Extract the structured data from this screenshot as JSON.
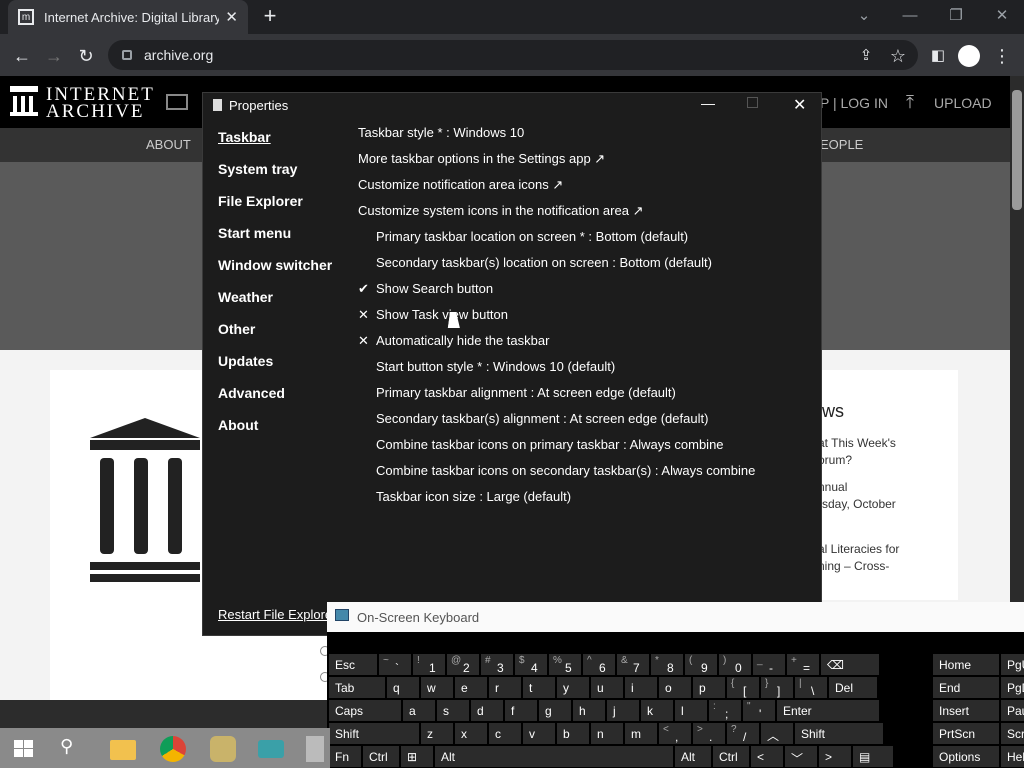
{
  "browser": {
    "tab_title": "Internet Archive: Digital Library o",
    "url": "archive.org"
  },
  "archive": {
    "logo_line1": "INTERNET",
    "logo_line2": "ARCHIVE",
    "header_right": "P | LOG IN",
    "upload": "UPLOAD",
    "nav_about": "ABOUT",
    "nav_people": "EOPLE",
    "news_title": "ws",
    "news_1": "at This Week's",
    "news_2": "orum?",
    "news_3": "nnual",
    "news_4": "rsday, October",
    "news_5": "al Literacies for",
    "news_6": "ning – Cross-",
    "news_7": ")"
  },
  "properties": {
    "title": "Properties",
    "sidebar": [
      "Taskbar",
      "System tray",
      "File Explorer",
      "Start menu",
      "Window switcher",
      "Weather",
      "Other",
      "Updates",
      "Advanced",
      "About"
    ],
    "options": [
      {
        "text": "Taskbar style * : Windows 10",
        "mark": "",
        "indent": false
      },
      {
        "text": "More taskbar options in the Settings app ↗",
        "mark": "",
        "indent": false
      },
      {
        "text": "Customize notification area icons ↗",
        "mark": "",
        "indent": false
      },
      {
        "text": "Customize system icons in the notification area ↗",
        "mark": "",
        "indent": false
      },
      {
        "text": "Primary taskbar location on screen * : Bottom (default)",
        "mark": "",
        "indent": true
      },
      {
        "text": "Secondary taskbar(s) location on screen : Bottom (default)",
        "mark": "",
        "indent": true
      },
      {
        "text": "Show Search button",
        "mark": "✔",
        "indent": true
      },
      {
        "text": "Show Task view button",
        "mark": "✕",
        "indent": true
      },
      {
        "text": "Automatically hide the taskbar",
        "mark": "✕",
        "indent": true
      },
      {
        "text": "Start button style * : Windows 10 (default)",
        "mark": "",
        "indent": true
      },
      {
        "text": "Primary taskbar alignment : At screen edge (default)",
        "mark": "",
        "indent": true
      },
      {
        "text": "Secondary taskbar(s) alignment : At screen edge (default)",
        "mark": "",
        "indent": true
      },
      {
        "text": "Combine taskbar icons on primary taskbar : Always combine",
        "mark": "",
        "indent": true
      },
      {
        "text": "Combine taskbar icons on secondary taskbar(s) : Always combine",
        "mark": "",
        "indent": true
      },
      {
        "text": "Taskbar icon size : Large (default)",
        "mark": "",
        "indent": true
      }
    ],
    "restart": "Restart File Explorer (",
    "colors": {
      "background": "#1c1c1c",
      "text": "#ffffff"
    }
  },
  "osk": {
    "title": "On-Screen Keyboard",
    "rows": [
      [
        {
          "m": "Esc",
          "w": 50
        },
        {
          "s": "~",
          "l": "`",
          "w": 34
        },
        {
          "s": "!",
          "l": "1",
          "w": 34
        },
        {
          "s": "@",
          "l": "2",
          "w": 34
        },
        {
          "s": "#",
          "l": "3",
          "w": 34
        },
        {
          "s": "$",
          "l": "4",
          "w": 34
        },
        {
          "s": "%",
          "l": "5",
          "w": 34
        },
        {
          "s": "^",
          "l": "6",
          "w": 34
        },
        {
          "s": "&",
          "l": "7",
          "w": 34
        },
        {
          "s": "*",
          "l": "8",
          "w": 34
        },
        {
          "s": "(",
          "l": "9",
          "w": 34
        },
        {
          "s": ")",
          "l": "0",
          "w": 34
        },
        {
          "s": "_",
          "l": "-",
          "w": 34
        },
        {
          "s": "+",
          "l": "=",
          "w": 34
        },
        {
          "m": "⌫",
          "w": 60
        }
      ],
      [
        {
          "m": "Tab",
          "w": 58
        },
        {
          "m": "q",
          "w": 34
        },
        {
          "m": "w",
          "w": 34
        },
        {
          "m": "e",
          "w": 34
        },
        {
          "m": "r",
          "w": 34
        },
        {
          "m": "t",
          "w": 34
        },
        {
          "m": "y",
          "w": 34
        },
        {
          "m": "u",
          "w": 34
        },
        {
          "m": "i",
          "w": 34
        },
        {
          "m": "o",
          "w": 34
        },
        {
          "m": "p",
          "w": 34
        },
        {
          "s": "{",
          "l": "[",
          "w": 34
        },
        {
          "s": "}",
          "l": "]",
          "w": 34
        },
        {
          "s": "|",
          "l": "\\",
          "w": 34
        },
        {
          "m": "Del",
          "w": 50
        }
      ],
      [
        {
          "m": "Caps",
          "w": 74
        },
        {
          "m": "a",
          "w": 34
        },
        {
          "m": "s",
          "w": 34
        },
        {
          "m": "d",
          "w": 34
        },
        {
          "m": "f",
          "w": 34
        },
        {
          "m": "g",
          "w": 34
        },
        {
          "m": "h",
          "w": 34
        },
        {
          "m": "j",
          "w": 34
        },
        {
          "m": "k",
          "w": 34
        },
        {
          "m": "l",
          "w": 34
        },
        {
          "s": ":",
          "l": ";",
          "w": 34
        },
        {
          "s": "\"",
          "l": "'",
          "w": 34
        },
        {
          "m": "Enter",
          "w": 104
        }
      ],
      [
        {
          "m": "Shift",
          "w": 92
        },
        {
          "m": "z",
          "w": 34
        },
        {
          "m": "x",
          "w": 34
        },
        {
          "m": "c",
          "w": 34
        },
        {
          "m": "v",
          "w": 34
        },
        {
          "m": "b",
          "w": 34
        },
        {
          "m": "n",
          "w": 34
        },
        {
          "m": "m",
          "w": 34
        },
        {
          "s": "<",
          "l": ",",
          "w": 34
        },
        {
          "s": ">",
          "l": ".",
          "w": 34
        },
        {
          "s": "?",
          "l": "/",
          "w": 34
        },
        {
          "m": "︿",
          "w": 34
        },
        {
          "m": "Shift",
          "w": 90
        }
      ],
      [
        {
          "m": "Fn",
          "w": 34
        },
        {
          "m": "Ctrl",
          "w": 38
        },
        {
          "m": "⊞",
          "w": 34
        },
        {
          "m": "Alt",
          "w": 240
        },
        {
          "m": "Alt",
          "w": 38
        },
        {
          "m": "Ctrl",
          "w": 38
        },
        {
          "m": "<",
          "w": 34
        },
        {
          "m": "﹀",
          "w": 34
        },
        {
          "m": ">",
          "w": 34
        },
        {
          "m": "▤",
          "w": 42
        }
      ]
    ],
    "side": [
      [
        "Home",
        "PgU"
      ],
      [
        "End",
        "PgD"
      ],
      [
        "Insert",
        "Pau"
      ],
      [
        "PrtScn",
        "Scr"
      ],
      [
        "Options",
        "Hel"
      ]
    ]
  }
}
